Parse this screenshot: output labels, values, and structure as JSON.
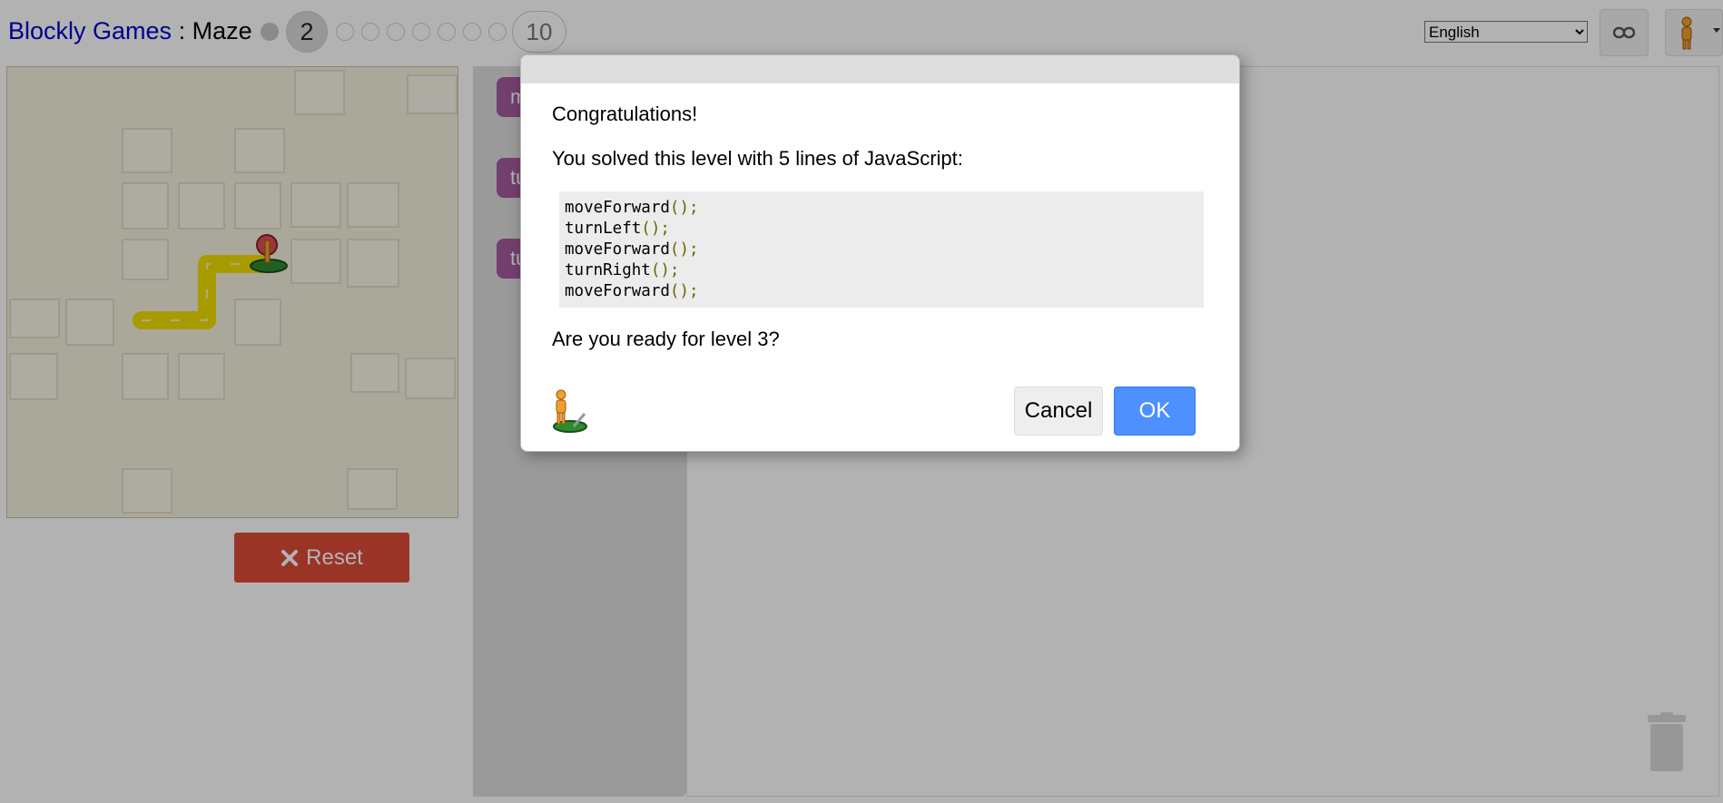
{
  "header": {
    "app_name": "Blockly Games",
    "separator": " : ",
    "game_name": "Maze",
    "current_level": "2",
    "last_level": "10",
    "language": "English",
    "language_options": [
      "English"
    ]
  },
  "maze": {
    "reset_label": "Reset"
  },
  "toolbox": {
    "blocks": [
      "m",
      "tu",
      "tu"
    ]
  },
  "dialog": {
    "title": "Congratulations!",
    "message": "You solved this level with 5 lines of JavaScript:",
    "code_lines": [
      {
        "name": "moveForward",
        "punct": "();"
      },
      {
        "name": "turnLeft",
        "punct": "();"
      },
      {
        "name": "moveForward",
        "punct": "();"
      },
      {
        "name": "turnRight",
        "punct": "();"
      },
      {
        "name": "moveForward",
        "punct": "();"
      }
    ],
    "question": "Are you ready for level 3?",
    "cancel_label": "Cancel",
    "ok_label": "OK"
  },
  "colors": {
    "link": "#0000cc",
    "reset": "#dd4b39",
    "block": "#a55b9f",
    "ok": "#4d90fe",
    "path": "#f1de00",
    "code_punct": "#666600"
  }
}
